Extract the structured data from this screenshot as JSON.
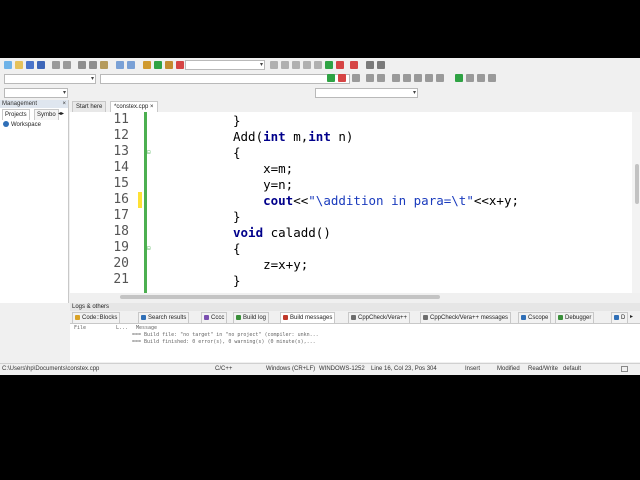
{
  "toolbar": {
    "build_target_value": "",
    "combo2_value": "",
    "combo3_value": ""
  },
  "management": {
    "title": "Management",
    "close": "×",
    "tabs": [
      "Projects",
      "Symbo"
    ],
    "tab_scroll": "◂▸",
    "workspace_label": "Workspace"
  },
  "editor": {
    "tabs": [
      {
        "label": "Start here"
      },
      {
        "label": "*constex.cpp",
        "close": "×"
      }
    ],
    "line_numbers": [
      "11",
      "12",
      "13",
      "14",
      "15",
      "16",
      "17",
      "18",
      "19",
      "20",
      "21"
    ],
    "lines": [
      {
        "t1": "}",
        "kw1": "",
        "t2": "",
        "kw2": "",
        "t3": "",
        "str": "",
        "t4": ""
      },
      {
        "t1": "Add(",
        "kw1": "int",
        "t2": " m,",
        "kw2": "int",
        "t3": " n)",
        "str": "",
        "t4": ""
      },
      {
        "t1": "{",
        "kw1": "",
        "t2": "",
        "kw2": "",
        "t3": "",
        "str": "",
        "t4": ""
      },
      {
        "t1": "    x=m;",
        "kw1": "",
        "t2": "",
        "kw2": "",
        "t3": "",
        "str": "",
        "t4": ""
      },
      {
        "t1": "    y=n;",
        "kw1": "",
        "t2": "",
        "kw2": "",
        "t3": "",
        "str": "",
        "t4": ""
      },
      {
        "t1": "    ",
        "kw1": "cout",
        "t2": "<<",
        "kw2": "",
        "t3": "",
        "str": "\"\\addition in para=\\t\"",
        "t4": "<<x+y;"
      },
      {
        "t1": "}",
        "kw1": "",
        "t2": "",
        "kw2": "",
        "t3": "",
        "str": "",
        "t4": ""
      },
      {
        "t1": "",
        "kw1": "void",
        "t2": " caladd()",
        "kw2": "",
        "t3": "",
        "str": "",
        "t4": ""
      },
      {
        "t1": "{",
        "kw1": "",
        "t2": "",
        "kw2": "",
        "t3": "",
        "str": "",
        "t4": ""
      },
      {
        "t1": "    z=x+y;",
        "kw1": "",
        "t2": "",
        "kw2": "",
        "t3": "",
        "str": "",
        "t4": ""
      },
      {
        "t1": "}",
        "kw1": "",
        "t2": "",
        "kw2": "",
        "t3": "",
        "str": "",
        "t4": ""
      }
    ]
  },
  "logs": {
    "title": "Logs & others",
    "tabs": [
      {
        "label": "Code::Blocks",
        "color": "#d9a227"
      },
      {
        "label": "Search results",
        "color": "#2f6fb7"
      },
      {
        "label": "Cccc",
        "color": "#7a4fb0"
      },
      {
        "label": "Build log",
        "color": "#3a8f3a"
      },
      {
        "label": "Build messages",
        "color": "#c0392b"
      },
      {
        "label": "CppCheck/Vera++",
        "color": "#6d6d6d"
      },
      {
        "label": "CppCheck/Vera++ messages",
        "color": "#6d6d6d"
      },
      {
        "label": "Cscope",
        "color": "#2f6fb7"
      },
      {
        "label": "Debugger",
        "color": "#3a8f3a"
      },
      {
        "label": "D",
        "color": "#2f6fb7"
      }
    ],
    "headers": {
      "file": "File",
      "line": "L...",
      "message": "Message"
    },
    "messages": [
      "=== Build file: \"no target\" in \"no project\" (compiler: unkn...",
      "=== Build finished: 0 error(s), 0 warning(s) (0 minute(s),..."
    ]
  },
  "status": {
    "path": "C:\\Users\\hp\\Documents\\constex.cpp",
    "language": "C/C++",
    "line_endings": "Windows (CR+LF)",
    "encoding": "WINDOWS-1252",
    "position": "Line 16, Col 23, Pos 304",
    "mode": "Insert",
    "modified": "Modified",
    "access": "Read/Write",
    "profile": "default"
  }
}
